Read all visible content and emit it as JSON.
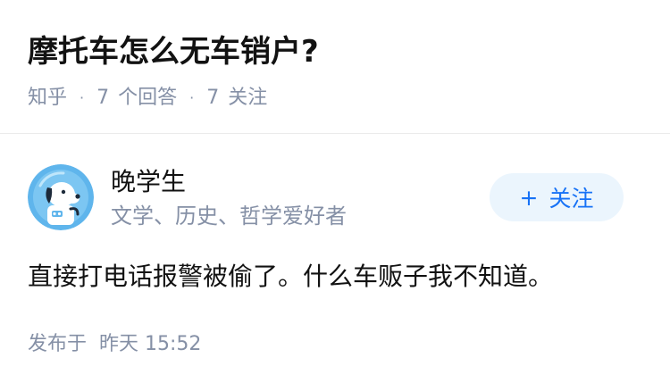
{
  "question": {
    "title": "摩托车怎么无车销户?",
    "source": "知乎",
    "answers_count": "7",
    "answers_label": "个回答",
    "followers_count": "7",
    "followers_label": "关注"
  },
  "answer": {
    "author_name": "晚学生",
    "author_bio": "文学、历史、哲学爱好者",
    "follow_label": "关注",
    "content": "直接打电话报警被偷了。什么车贩子我不知道。",
    "published_label": "发布于",
    "published_time": "昨天 15:52"
  },
  "colors": {
    "accent": "#1772f6",
    "follow_bg": "#ebf5fd",
    "meta_text": "#8590a6",
    "avatar_bg": "#5fb5ec"
  },
  "icons": {
    "avatar": "cartoon-dog-astronaut-avatar",
    "follow": "plus-icon"
  }
}
